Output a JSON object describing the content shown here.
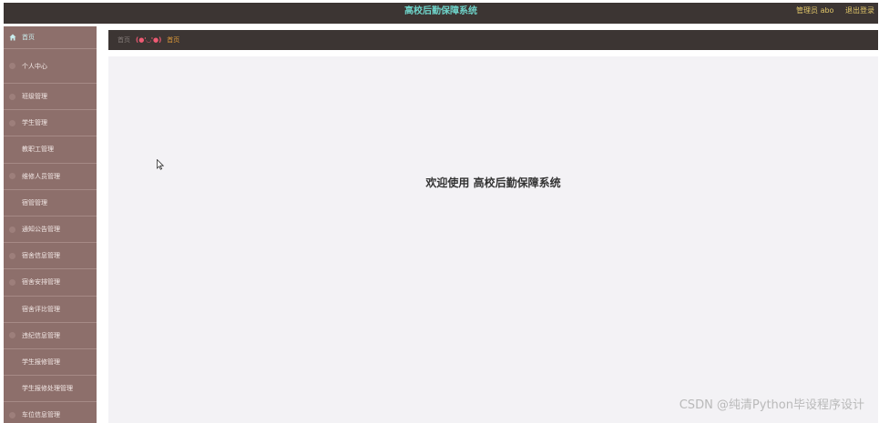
{
  "header": {
    "title": "高校后勤保障系统",
    "user": "管理员 abo",
    "logout": "退出登录"
  },
  "sidebar": {
    "items": [
      {
        "label": "首页"
      },
      {
        "label": "个人中心"
      },
      {
        "label": "班级管理"
      },
      {
        "label": "学生管理"
      },
      {
        "label": "教职工管理"
      },
      {
        "label": "维修人员管理"
      },
      {
        "label": "宿管管理"
      },
      {
        "label": "通知公告管理"
      },
      {
        "label": "宿舍信息管理"
      },
      {
        "label": "宿舍安排管理"
      },
      {
        "label": "宿舍评比管理"
      },
      {
        "label": "违纪信息管理"
      },
      {
        "label": "学生报修管理"
      },
      {
        "label": "学生报修处理管理"
      },
      {
        "label": "车位信息管理"
      }
    ]
  },
  "breadcrumb": {
    "first": "首页",
    "emoji": "(●'◡'●)",
    "current": "首页"
  },
  "main": {
    "welcome": "欢迎使用 高校后勤保障系统"
  },
  "watermark": "CSDN @纯清Python毕设程序设计"
}
